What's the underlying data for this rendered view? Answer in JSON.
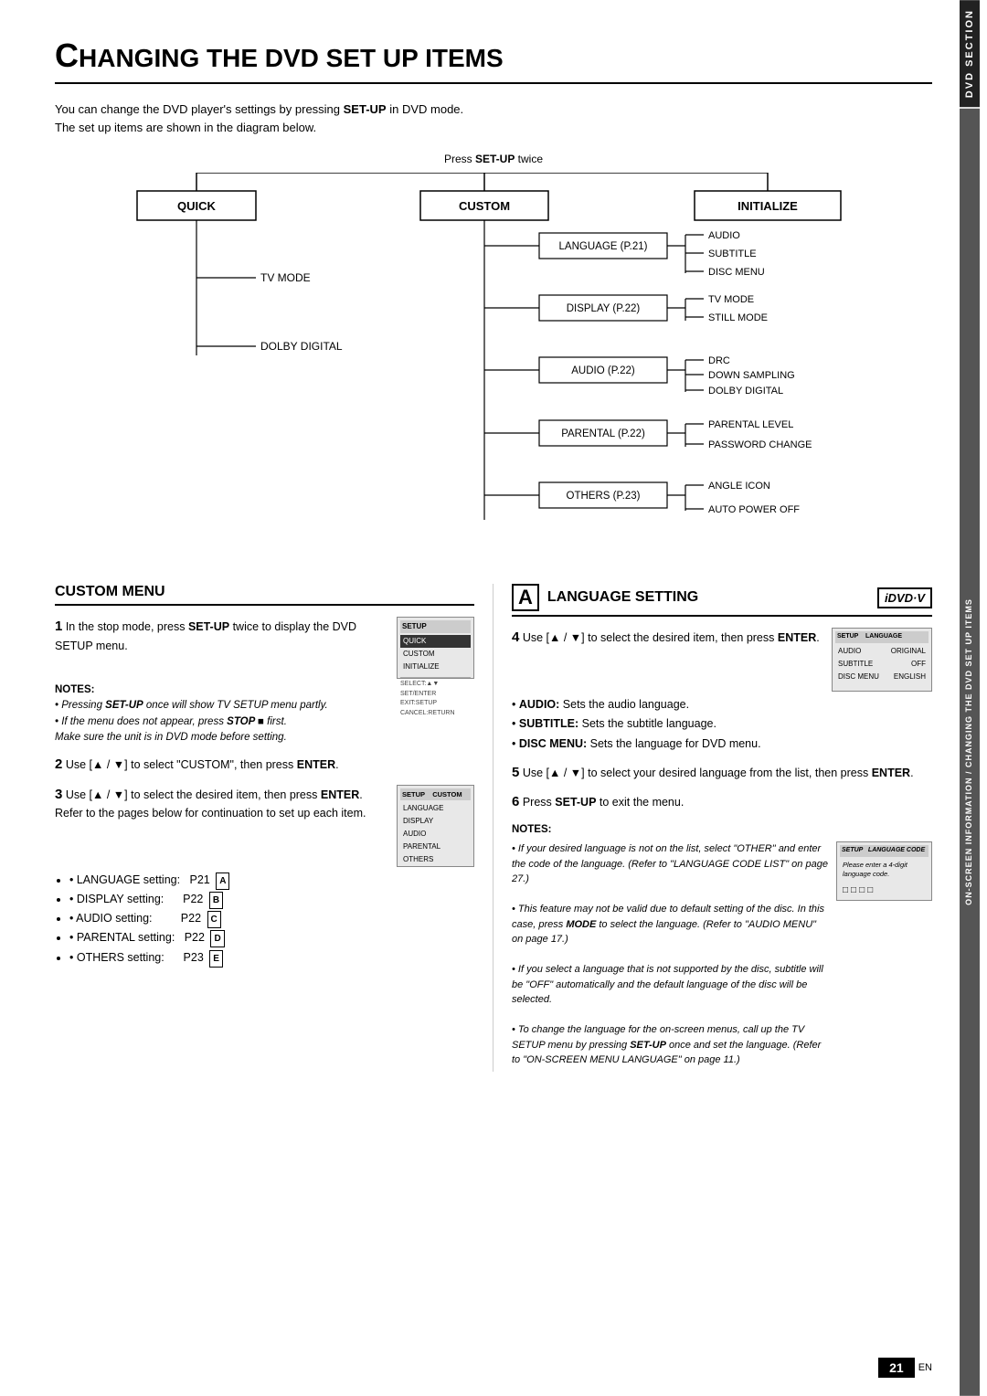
{
  "page": {
    "title_prefix": "C",
    "title_rest": "HANGING THE DVD SET UP ITEMS",
    "intro1": "You can change the DVD player's settings by pressing ",
    "intro1_bold": "SET-UP",
    "intro1_end": " in DVD mode.",
    "intro2": "The set up items are shown in the diagram below.",
    "press_setup": "Press ",
    "press_setup_bold": "SET-UP",
    "press_setup_end": " twice"
  },
  "sidebar": {
    "dvd_section": "DVD SECTION",
    "long_label": "ON-SCREEN INFORMATION / CHANGING THE DVD SET UP ITEMS"
  },
  "diagram": {
    "top_boxes": [
      "QUICK",
      "CUSTOM",
      "INITIALIZE"
    ],
    "quick_sub": [
      "TV MODE",
      "DOLBY DIGITAL"
    ],
    "custom_branches": [
      {
        "box": "LANGUAGE (P.21)",
        "items": [
          "AUDIO",
          "SUBTITLE",
          "DISC MENU"
        ]
      },
      {
        "box": "DISPLAY (P.22)",
        "items": [
          "TV MODE",
          "STILL MODE"
        ]
      },
      {
        "box": "AUDIO (P.22)",
        "items": [
          "DRC",
          "DOWN SAMPLING",
          "DOLBY DIGITAL"
        ]
      },
      {
        "box": "PARENTAL (P.22)",
        "items": [
          "PARENTAL LEVEL",
          "PASSWORD CHANGE"
        ]
      },
      {
        "box": "OTHERS (P.23)",
        "items": [
          "ANGLE ICON",
          "AUTO POWER OFF"
        ]
      }
    ]
  },
  "custom_menu": {
    "title": "CUSTOM MENU",
    "step1": {
      "num": "1",
      "text1": "In the stop mode, press ",
      "text1_bold": "SET-UP",
      "text1_end": " twice to display the DVD SETUP menu.",
      "notes_title": "NOTES:",
      "note1_bold": "SET-UP",
      "note1_text": " once will show TV SETUP menu partly.",
      "note2_pre": "If the menu does not appear, press ",
      "note2_bold": "STOP ■",
      "note2_end": " first.",
      "note3": "Make sure the unit is in DVD mode before setting."
    },
    "step2": {
      "num": "2",
      "text": "Use [▲ / ▼] to select \"CUSTOM\", then press ",
      "text_bold": "ENTER",
      "text_end": "."
    },
    "step3": {
      "num": "3",
      "text1": "Use [▲ / ▼] to select the desired item, then press ",
      "text1_bold": "ENTER",
      "text1_end": ".",
      "text2": "Refer to the pages below for continuation to set up each item."
    },
    "bullet_items": [
      {
        "label": "LANGUAGE setting:",
        "page": "P21",
        "badge": "A"
      },
      {
        "label": "DISPLAY setting:",
        "page": "P22",
        "badge": "B"
      },
      {
        "label": "AUDIO setting:",
        "page": "P22",
        "badge": "C"
      },
      {
        "label": "PARENTAL setting:",
        "page": "P22",
        "badge": "D"
      },
      {
        "label": "OTHERS setting:",
        "page": "P23",
        "badge": "E"
      }
    ],
    "screen1": {
      "title": "SETUP",
      "rows": [
        {
          "text": "QUICK",
          "highlight": true
        },
        {
          "text": "CUSTOM",
          "highlight": false
        },
        {
          "text": "INITIALIZE",
          "highlight": false
        }
      ],
      "footer1": "SELECT:▲▼  SET/ENTER",
      "footer2": "EXIT:SETUP  CANCEL:RETURN"
    },
    "screen2": {
      "title": "SETUP   CUSTOM",
      "rows": [
        {
          "text": "LANGUAGE",
          "highlight": false
        },
        {
          "text": "DISPLAY",
          "highlight": false
        },
        {
          "text": "AUDIO",
          "highlight": false
        },
        {
          "text": "PARENTAL",
          "highlight": false
        },
        {
          "text": "OTHERS",
          "highlight": false
        }
      ]
    }
  },
  "language_setting": {
    "badge": "A",
    "title": "LANGUAGE SETTING",
    "dvd_badge": "iDVD·V",
    "step4": {
      "num": "4",
      "text1": "Use [▲ / ▼] to select the desired item, then press ",
      "text1_bold": "ENTER",
      "text1_end": "."
    },
    "bullets4": [
      {
        "bullet": "AUDIO:",
        "text": "  Sets the audio language."
      },
      {
        "bullet": "SUBTITLE:",
        "text": "  Sets the subtitle language."
      },
      {
        "bullet": "DISC MENU:",
        "text": " Sets the language for DVD menu."
      }
    ],
    "step5": {
      "num": "5",
      "text1": "Use [▲ / ▼] to select your desired language from the list, then press ",
      "text1_bold": "ENTER",
      "text1_end": "."
    },
    "step6": {
      "num": "6",
      "text1": "Press ",
      "text1_bold": "SET-UP",
      "text1_end": " to exit the menu."
    },
    "notes_title": "NOTES:",
    "notes": [
      "If your desired language is not on the list, select \"OTHER\" and enter the code of the language. (Refer to \"LANGUAGE CODE LIST\" on page 27.)",
      "This feature may not be valid due to default setting of the disc. In this case, press MODE to select the language. (Refer to \"AUDIO MENU\" on page 17.)",
      "If you select a language that is not supported by the disc, subtitle will be \"OFF\" automatically and the default language of the disc will be selected.",
      "To change the language for the on-screen menus, call up the TV SETUP menu by pressing SET-UP once and set the language. (Refer to \"ON-SCREEN MENU LANGUAGE\" on page 11.)"
    ],
    "screen_lang": {
      "title": "SETUP   LANGUAGE",
      "rows": [
        {
          "label": "AUDIO",
          "value": "ORIGINAL"
        },
        {
          "label": "SUBTITLE",
          "value": "OFF"
        },
        {
          "label": "DISC MENU",
          "value": "ENGLISH"
        }
      ]
    },
    "screen_lang2": {
      "title": "SETUP   LANGUAGE CODE",
      "text": "Please enter a 4-digit language code.",
      "boxes": "□□□□"
    }
  },
  "page_number": "21",
  "en_label": "EN"
}
